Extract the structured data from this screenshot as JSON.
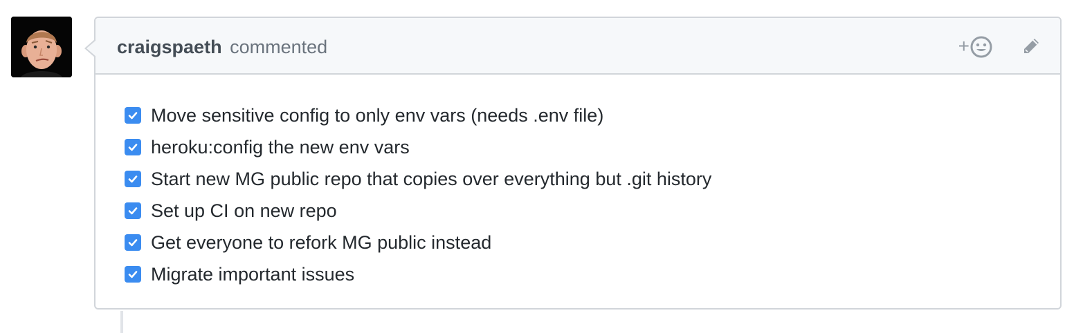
{
  "comment": {
    "author": "craigspaeth",
    "action": "commented"
  },
  "icons": {
    "avatar": "user-avatar",
    "reaction": "smiley-icon",
    "edit": "pencil-icon"
  },
  "reaction_plus": "+",
  "tasks": [
    {
      "label": "Move sensitive config to only env vars (needs .env file)",
      "checked": true
    },
    {
      "label": "heroku:config the new env vars",
      "checked": true
    },
    {
      "label": "Start new MG public repo that copies over everything but .git history",
      "checked": true
    },
    {
      "label": "Set up CI on new repo",
      "checked": true
    },
    {
      "label": "Get everyone to refork MG public instead",
      "checked": true
    },
    {
      "label": "Migrate important issues",
      "checked": true
    }
  ],
  "colors": {
    "checkbox": "#3b8cf0",
    "header_bg": "#f6f8fa",
    "border": "#d1d5da"
  }
}
